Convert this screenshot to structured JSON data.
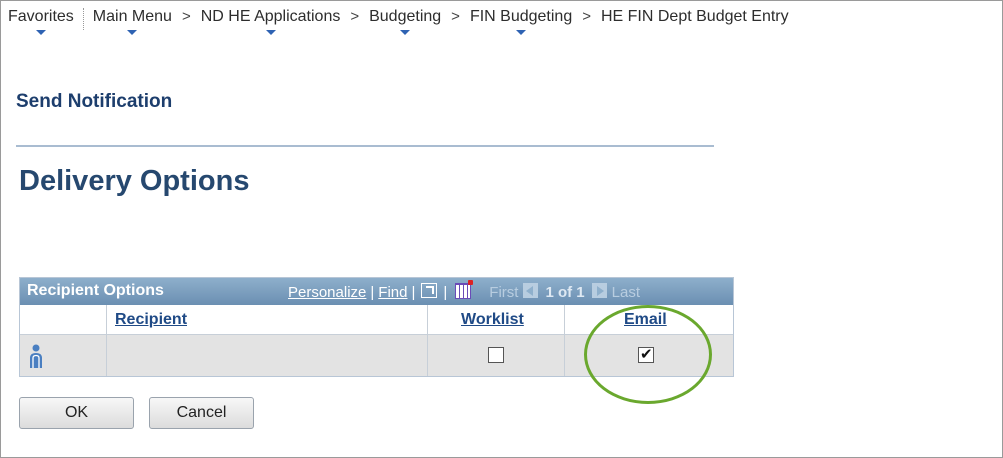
{
  "nav": {
    "favorites": "Favorites",
    "separator": ">",
    "crumbs": [
      "Main Menu",
      "ND HE Applications",
      "Budgeting",
      "FIN Budgeting",
      "HE FIN Dept Budget Entry"
    ]
  },
  "page": {
    "send_title": "Send Notification",
    "delivery_title": "Delivery Options"
  },
  "grid": {
    "title": "Recipient Options",
    "personalize": "Personalize",
    "find": "Find",
    "divider": "|",
    "first": "First",
    "count": "1 of 1",
    "last": "Last",
    "columns": {
      "recipient": "Recipient",
      "worklist": "Worklist",
      "email": "Email"
    },
    "rows": [
      {
        "recipient": "",
        "worklist": false,
        "email": true
      }
    ]
  },
  "buttons": {
    "ok": "OK",
    "cancel": "Cancel"
  },
  "colors": {
    "highlight_oval": "#6aa82e",
    "header": "#6b8fb2",
    "heading": "#1d3e6d"
  },
  "icons": [
    "chevron-down-icon",
    "person-icon",
    "new-window-icon",
    "download-spreadsheet-icon",
    "prev-arrow-icon",
    "next-arrow-icon"
  ]
}
